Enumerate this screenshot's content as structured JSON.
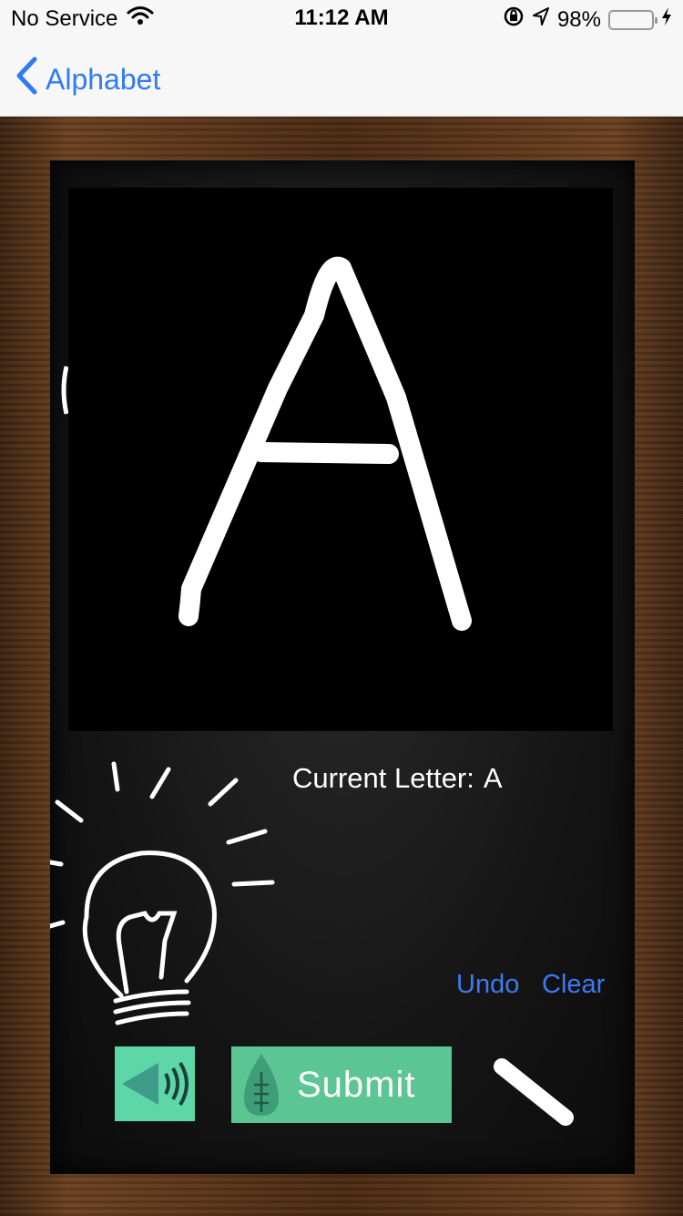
{
  "status_bar": {
    "carrier": "No Service",
    "time": "11:12 AM",
    "battery": "98%",
    "battery_level": 0.98
  },
  "nav": {
    "back_label": "Alphabet"
  },
  "canvas": {
    "drawn_letter": "A"
  },
  "current_letter": {
    "label": "Current Letter:",
    "value": "A"
  },
  "actions": {
    "undo": "Undo",
    "clear": "Clear",
    "submit": "Submit"
  },
  "icons": {
    "back": "chevron-left-icon",
    "wifi": "wifi-icon",
    "lock_rotation": "orientation-lock-icon",
    "location": "location-arrow-icon",
    "battery": "battery-icon",
    "charging": "bolt-icon",
    "bulb": "lightbulb-icon",
    "sound": "speaker-icon",
    "leaf": "leaf-icon",
    "chalk": "chalk-icon"
  },
  "colors": {
    "link_blue": "#3b7bf2",
    "submit_green": "#5cc594",
    "sound_green": "#5dd6a8"
  }
}
